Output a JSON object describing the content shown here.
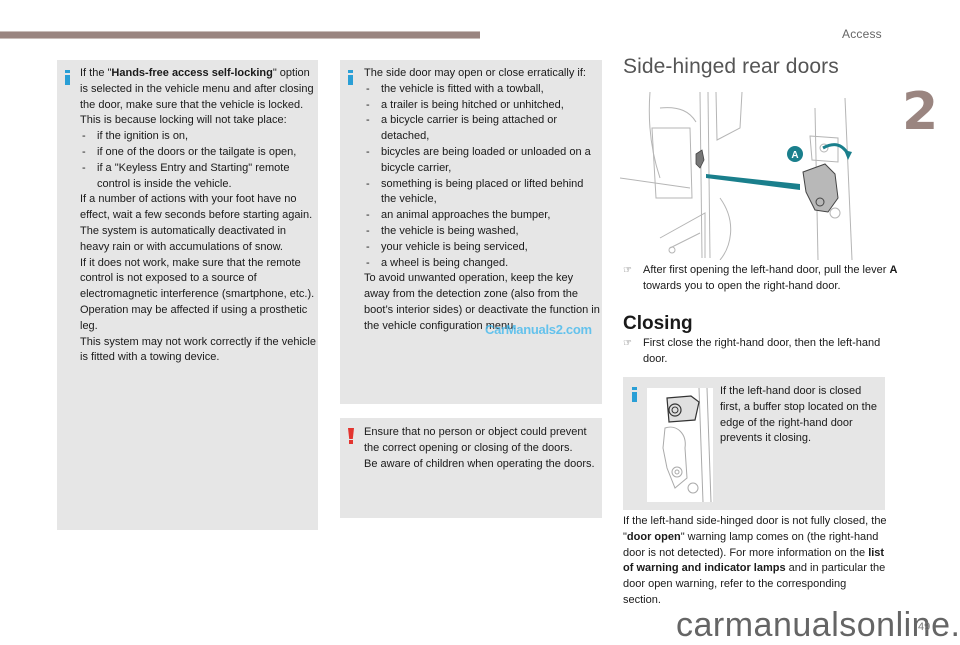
{
  "header": {
    "section_title": "Access",
    "chapter_number": "2"
  },
  "col1": {
    "type": "info",
    "paragraphs": [
      {
        "kind": "p",
        "segments": [
          {
            "t": "If the \""
          },
          {
            "t": "Hands-free access self-locking",
            "b": true
          },
          {
            "t": "\" option is selected in the vehicle menu and after closing the door, make sure that the vehicle is locked."
          }
        ]
      },
      {
        "kind": "p",
        "segments": [
          {
            "t": "This is because locking will not take place:"
          }
        ]
      },
      {
        "kind": "li",
        "segments": [
          {
            "t": "if the ignition is on,"
          }
        ]
      },
      {
        "kind": "li",
        "segments": [
          {
            "t": "if one of the doors or the tailgate is open,"
          }
        ]
      },
      {
        "kind": "li",
        "segments": [
          {
            "t": "if a \"Keyless Entry and Starting\" remote control is inside the vehicle."
          }
        ]
      },
      {
        "kind": "p",
        "segments": [
          {
            "t": "If a number of actions with your foot have no effect, wait a few seconds before starting again."
          }
        ]
      },
      {
        "kind": "p",
        "segments": [
          {
            "t": "The system is automatically deactivated in heavy rain or with accumulations of snow."
          }
        ]
      },
      {
        "kind": "p",
        "segments": [
          {
            "t": "If it does not work, make sure that the remote control is not exposed to a source of electromagnetic interference (smartphone, etc.)."
          }
        ]
      },
      {
        "kind": "p",
        "segments": [
          {
            "t": "Operation may be affected if using a prosthetic leg."
          }
        ]
      },
      {
        "kind": "p",
        "segments": [
          {
            "t": "This system may not work correctly if the vehicle is fitted with a towing device."
          }
        ]
      }
    ]
  },
  "col2_info": {
    "type": "info",
    "paragraphs": [
      {
        "kind": "p",
        "segments": [
          {
            "t": "The side door may open or close erratically if:"
          }
        ]
      },
      {
        "kind": "li",
        "segments": [
          {
            "t": "the vehicle is fitted with a towball,"
          }
        ]
      },
      {
        "kind": "li",
        "segments": [
          {
            "t": "a trailer is being hitched or unhitched,"
          }
        ]
      },
      {
        "kind": "li",
        "segments": [
          {
            "t": "a bicycle carrier is being attached or detached,"
          }
        ]
      },
      {
        "kind": "li",
        "segments": [
          {
            "t": "bicycles are being loaded or unloaded on a bicycle carrier,"
          }
        ]
      },
      {
        "kind": "li",
        "segments": [
          {
            "t": "something is being placed or lifted behind the vehicle,"
          }
        ]
      },
      {
        "kind": "li",
        "segments": [
          {
            "t": "an animal approaches the bumper,"
          }
        ]
      },
      {
        "kind": "li",
        "segments": [
          {
            "t": "the vehicle is being washed,"
          }
        ]
      },
      {
        "kind": "li",
        "segments": [
          {
            "t": "your vehicle is being serviced,"
          }
        ]
      },
      {
        "kind": "li",
        "segments": [
          {
            "t": "a wheel is being changed."
          }
        ]
      },
      {
        "kind": "p",
        "segments": [
          {
            "t": "To avoid unwanted operation, keep the key away from the detection zone (also from the boot’s interior sides) or deactivate the function in the vehicle configuration menu."
          }
        ]
      }
    ]
  },
  "col2_warning": {
    "type": "warning",
    "paragraphs": [
      {
        "kind": "p",
        "segments": [
          {
            "t": "Ensure that no person or object could prevent the correct opening or closing of the doors."
          }
        ]
      },
      {
        "kind": "p",
        "segments": [
          {
            "t": "Be aware of children when operating the doors."
          }
        ]
      }
    ]
  },
  "col3": {
    "title": "Side-hinged rear doors",
    "figure_label": "A",
    "step1_segments": [
      {
        "t": "After first opening the left-hand door, pull the lever "
      },
      {
        "t": "A",
        "b": true
      },
      {
        "t": " towards you to open the right-hand door."
      }
    ],
    "closing_heading": "Closing",
    "step2": "First close the right-hand door, then the left-hand door.",
    "info_box_text": "If the left-hand door is closed first, a buffer stop located on the edge of the right-hand door prevents it closing.",
    "footer_segments": [
      {
        "t": "If the left-hand side-hinged door is not fully closed, the \""
      },
      {
        "t": "door open",
        "b": true
      },
      {
        "t": "\" warning lamp comes on (the right-hand door is not detected). For more information on the "
      },
      {
        "t": "list of warning and indicator lamps",
        "b": true
      },
      {
        "t": " and in particular the door open warning, refer to the corresponding section."
      }
    ]
  },
  "watermarks": {
    "overlay": "CarManuals2.com",
    "footer": "carmanualsonline.info"
  },
  "page_number": "49",
  "colors": {
    "accent": "#9a8580",
    "info": "#2a9fd6",
    "warning": "#e3342f",
    "panel": "#e6e6e6",
    "figure_arrow": "#1a7f8c"
  }
}
